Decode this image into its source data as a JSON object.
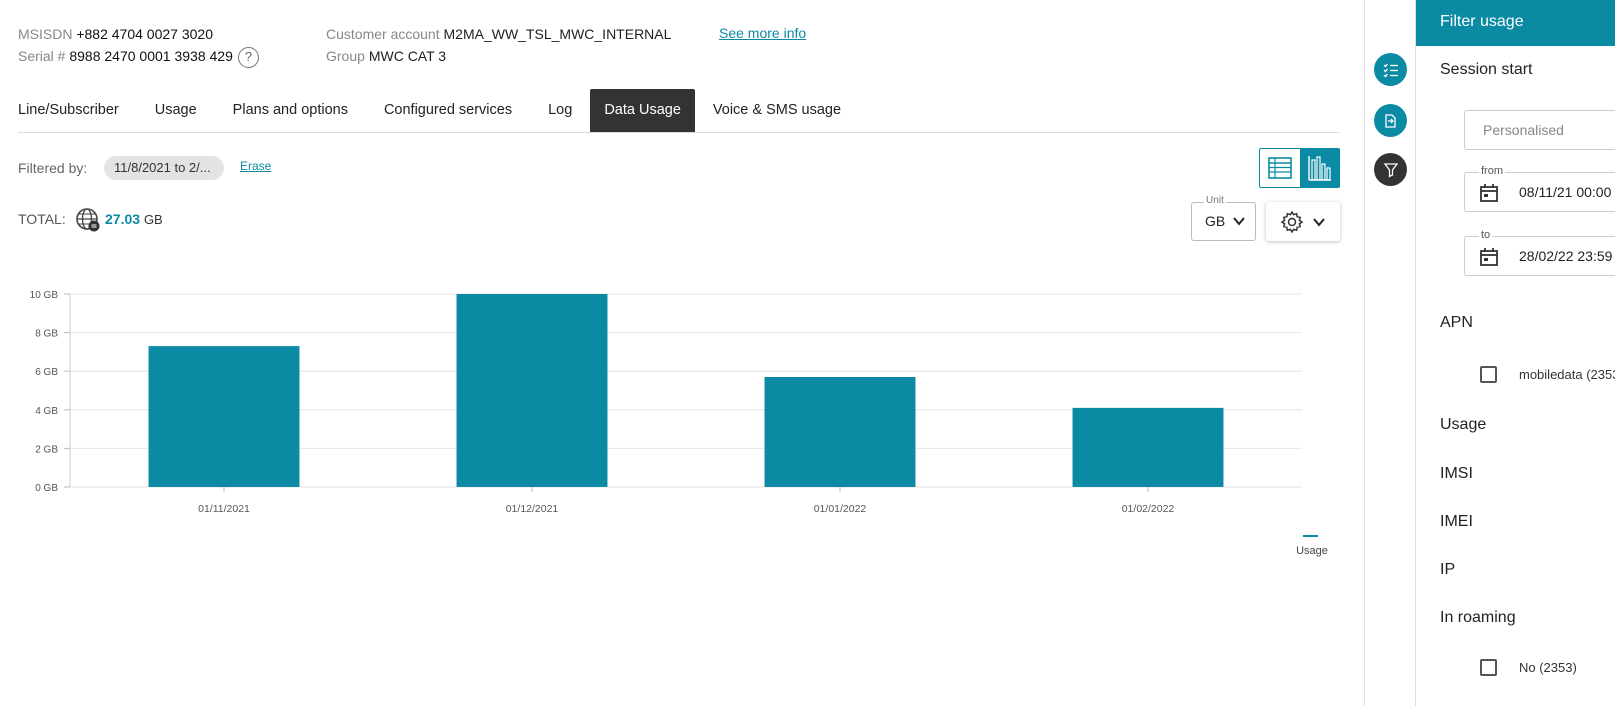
{
  "header": {
    "msisdn_label": "MSISDN",
    "msisdn_value": "+882 4704 0027 3020",
    "serial_label": "Serial #",
    "serial_value": "8988 2470 0001 3938 429",
    "help_glyph": "?",
    "customer_label": "Customer account",
    "customer_value": "M2MA_WW_TSL_MWC_INTERNAL",
    "group_label": "Group",
    "group_value": "MWC CAT 3",
    "see_more": "See more info"
  },
  "tabs": [
    {
      "label": "Line/Subscriber",
      "active": false
    },
    {
      "label": "Usage",
      "active": false
    },
    {
      "label": "Plans and options",
      "active": false
    },
    {
      "label": "Configured services",
      "active": false
    },
    {
      "label": "Log",
      "active": false
    },
    {
      "label": "Data Usage",
      "active": true
    },
    {
      "label": "Voice & SMS usage",
      "active": false
    }
  ],
  "filter": {
    "label": "Filtered by:",
    "chip": "11/8/2021 to 2/...",
    "erase": "Erase"
  },
  "total": {
    "label": "TOTAL:",
    "value": "27.03",
    "unit": "GB"
  },
  "unit_select": {
    "legend": "Unit",
    "value": "GB"
  },
  "chart_data": {
    "type": "bar",
    "categories": [
      "01/11/2021",
      "01/12/2021",
      "01/01/2022",
      "01/02/2022"
    ],
    "series": [
      {
        "name": "Usage",
        "values": [
          7.3,
          10.0,
          5.7,
          4.1
        ]
      }
    ],
    "y_ticks": [
      "0 GB",
      "2 GB",
      "4 GB",
      "6 GB",
      "8 GB",
      "10 GB"
    ],
    "ylim": [
      0,
      10
    ],
    "grid": true,
    "legend": "bottom-right",
    "bar_color": "#0b8aa3"
  },
  "panel": {
    "title": "Filter usage",
    "session_start": "Session start",
    "personalised_placeholder": "Personalised",
    "from_legend": "from",
    "from_value": "08/11/21 00:00",
    "to_legend": "to",
    "to_value": "28/02/22 23:59",
    "apn": "APN",
    "apn_option": "mobiledata (2353)",
    "usage": "Usage",
    "imsi": "IMSI",
    "imei": "IMEI",
    "ip": "IP",
    "roaming": "In roaming",
    "roaming_option": "No (2353)"
  },
  "colors": {
    "accent": "#0b8aa3",
    "dark": "#333333"
  }
}
